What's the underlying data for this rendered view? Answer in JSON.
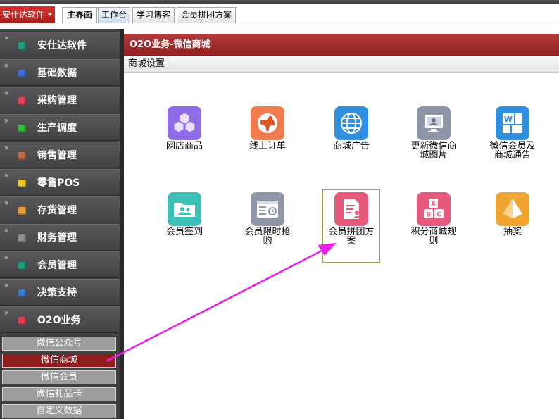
{
  "header": {
    "app_menu_label": "安仕达软件",
    "tabs": [
      {
        "label": "主界面",
        "active": true
      },
      {
        "label": "工作台",
        "active": false
      },
      {
        "label": "学习博客",
        "active": false
      },
      {
        "label": "会员拼团方案",
        "active": false
      }
    ]
  },
  "sidebar": {
    "items": [
      {
        "label": "安仕达软件",
        "color": "#1f9e7a"
      },
      {
        "label": "基础数据",
        "color": "#3b6fd6"
      },
      {
        "label": "采购管理",
        "color": "#e0415b"
      },
      {
        "label": "生产调度",
        "color": "#2fbf3a"
      },
      {
        "label": "销售管理",
        "color": "#b86a4a"
      },
      {
        "label": "零售POS",
        "color": "#e8c92a"
      },
      {
        "label": "存货管理",
        "color": "#e6a23c"
      },
      {
        "label": "财务管理",
        "color": "#8e8e8e"
      },
      {
        "label": "会员管理",
        "color": "#1f9e7a"
      },
      {
        "label": "决策支持",
        "color": "#3a7bd5"
      },
      {
        "label": "O2O业务",
        "color": "#e0415b"
      }
    ],
    "subitems": [
      {
        "label": "微信公众号",
        "active": false
      },
      {
        "label": "微信商城",
        "active": true
      },
      {
        "label": "微信会员",
        "active": false
      },
      {
        "label": "微信礼品卡",
        "active": false
      },
      {
        "label": "自定义数据",
        "active": false
      }
    ]
  },
  "main": {
    "title": "O2O业务-微信商城",
    "section_label": "商城设置",
    "tiles": [
      {
        "label": "网店商品",
        "icon": "cubes-icon",
        "color": "#8f6be8"
      },
      {
        "label": "线上订单",
        "icon": "globe-icon",
        "color": "#f07c4e"
      },
      {
        "label": "商城广告",
        "icon": "world-grid-icon",
        "color": "#2f8fe0"
      },
      {
        "label": "更新微信商\n城图片",
        "icon": "monitor-icon",
        "color": "#8f96a8"
      },
      {
        "label": "微信会员及\n商城通告",
        "icon": "office-tiles-icon",
        "color": "#2f8fe0"
      },
      {
        "label": "会员签到",
        "icon": "folder-people-icon",
        "color": "#3cc0b8"
      },
      {
        "label": "会员限时抢\n购",
        "icon": "browser-clock-icon",
        "color": "#8f96a8"
      },
      {
        "label": "会员拼团方\n案",
        "icon": "document-user-icon",
        "color": "#e85a7b"
      },
      {
        "label": "积分商城规\n则",
        "icon": "abc-blocks-icon",
        "color": "#e85a7b"
      },
      {
        "label": "抽奖",
        "icon": "pyramid-icon",
        "color": "#f0a531"
      }
    ]
  },
  "annotation": {
    "arrow_color": "#e81ee8"
  }
}
